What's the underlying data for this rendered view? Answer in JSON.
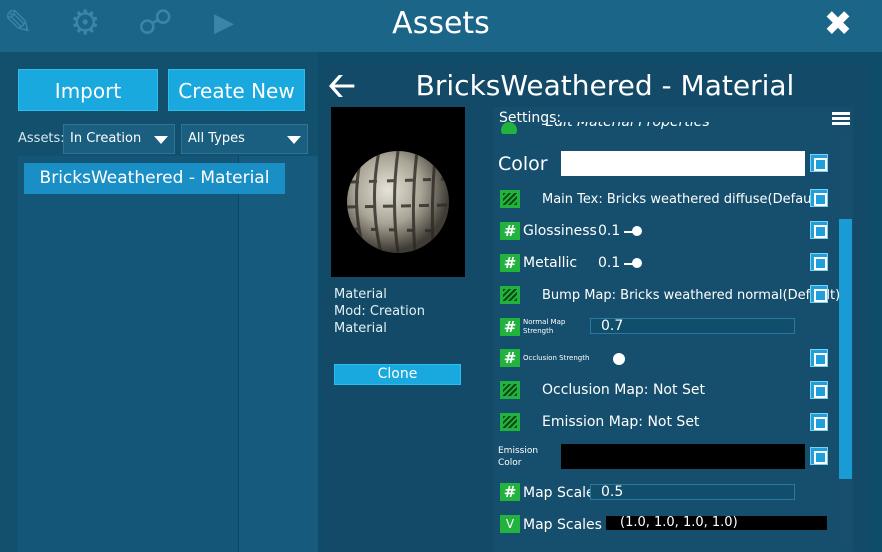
{
  "window": {
    "title": "Assets",
    "close_label": "✖"
  },
  "toolbar": {
    "import_label": "Import",
    "create_new_label": "Create New",
    "assets_label": "Assets:",
    "filter_creation": "In Creation",
    "filter_type": "All Types"
  },
  "asset_list": {
    "items": [
      {
        "label": "BricksWeathered - Material"
      }
    ]
  },
  "detail": {
    "title": "BricksWeathered - Material",
    "info_lines": [
      "Material",
      "Mod: Creation",
      "Material"
    ],
    "clone_label": "Clone"
  },
  "settings": {
    "label": "Settings:",
    "section_header": "Edit Material Properties",
    "color_label": "Color",
    "main_tex_label": "Main Tex: Bricks weathered diffuse(Default)",
    "glossiness_label": "Glossiness",
    "glossiness_value": "0.1",
    "metallic_label": "Metallic",
    "metallic_value": "0.1",
    "bump_map_label": "Bump Map: Bricks weathered normal(Default)",
    "normal_strength_label": "Normal Map Strength",
    "normal_strength_value": "0.7",
    "occlusion_strength_label": "Occlusion Strength",
    "occlusion_map_label": "Occlusion Map: Not Set",
    "emission_map_label": "Emission Map: Not Set",
    "emission_color_label": "Emission Color",
    "map_scale_label": "Map Scale",
    "map_scale_value": "0.5",
    "map_scales_label": "Map Scales",
    "map_scales_value": "(1.0, 1.0, 1.0, 1.0)",
    "vector_glyph": "V",
    "hash_glyph": "#"
  },
  "colors": {
    "accent": "#1a9bd6",
    "toggle_green": "#21b33d",
    "panel_bg": "#124a67"
  }
}
